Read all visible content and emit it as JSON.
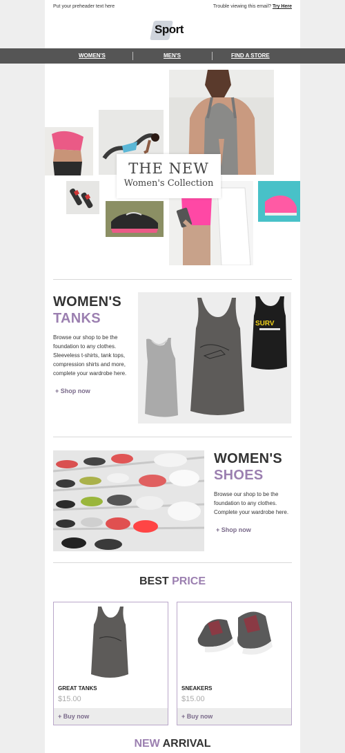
{
  "preheader": {
    "text": "Put your preheader text here"
  },
  "trouble": {
    "text": "Trouble viewing this email?",
    "link": "Try Here"
  },
  "logo": {
    "text": "Sport"
  },
  "nav": {
    "items": [
      "WOMEN'S",
      "MEN'S",
      "FIND A STORE"
    ]
  },
  "hero": {
    "line1": "THE NEW",
    "line2": "Women's Collection"
  },
  "tanks": {
    "title1": "WOMEN'S",
    "title2": "TANKS",
    "body": "Browse our shop to be the foundation to any clothes. Sleeveless t-shirts, tank tops, compression shirts and more, complete your wardrobe here.",
    "link": "+ Shop now"
  },
  "shoes": {
    "title1": "WOMEN'S",
    "title2": "SHOES",
    "body": "Browse our shop to be the foundation to any clothes. Complete your wardrobe here.",
    "link": "+ Shop now"
  },
  "best_price": {
    "title1": "BEST",
    "title2": "PRICE",
    "products": [
      {
        "name": "GREAT TANKS",
        "price": "$15.00",
        "button": "+ Buy now"
      },
      {
        "name": "SNEAKERS",
        "price": "$15.00",
        "button": "+ Buy now"
      }
    ]
  },
  "new_arrival": {
    "title1": "NEW",
    "title2": "ARRIVAL"
  },
  "colors": {
    "accent": "#9b7fb0",
    "nav_bg": "#555555",
    "page_bg": "#eeeeee"
  },
  "tank_print": {
    "text": "SURV"
  }
}
